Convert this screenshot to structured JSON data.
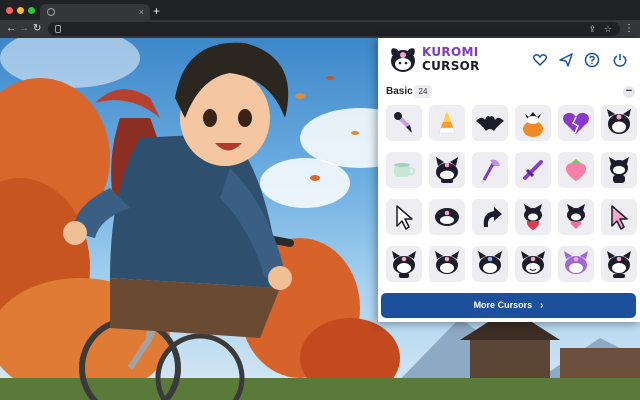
{
  "browser": {
    "tab_close_glyph": "×",
    "new_tab_glyph": "+",
    "back_glyph": "←",
    "forward_glyph": "→",
    "reload_glyph": "↻",
    "share_glyph": "⇪",
    "star_glyph": "☆",
    "menu_glyph": "⋮"
  },
  "extension": {
    "brand_line1": "KUROMI",
    "brand_line2": "CURSOR",
    "header_icons": [
      "heart-icon",
      "send-icon",
      "help-icon",
      "power-icon"
    ],
    "section": {
      "title": "Basic",
      "count": "24",
      "collapse_glyph": "−"
    },
    "cursors": [
      "kuromi-pen-cursor",
      "candy-corn-cursor",
      "bat-cursor",
      "pumpkin-kuromi-cursor",
      "broken-heart-cursor",
      "kuromi-face-cursor",
      "teacup-cursor",
      "kuromi-bunny-cursor",
      "axe-cursor",
      "sword-cursor",
      "strawberry-cursor",
      "kuromi-sitting-cursor",
      "arrow-cursor",
      "kuromi-head-cursor",
      "curved-arrow-cursor",
      "kuromi-strawberry-cursor",
      "kuromi-heart-cursor",
      "pink-arrow-cursor",
      "kuromi-sad-cursor",
      "kuromi-happy-cursor",
      "kuromi-blue-cursor",
      "kuromi-smile-cursor",
      "kuromi-purple-cursor",
      "kuromi-wink-cursor"
    ],
    "more_button_label": "More Cursors",
    "more_button_arrow": "›"
  },
  "colors": {
    "brand_purple": "#7d3cc0",
    "button_blue": "#1c4f9c",
    "tile_bg": "#eeeef2"
  }
}
